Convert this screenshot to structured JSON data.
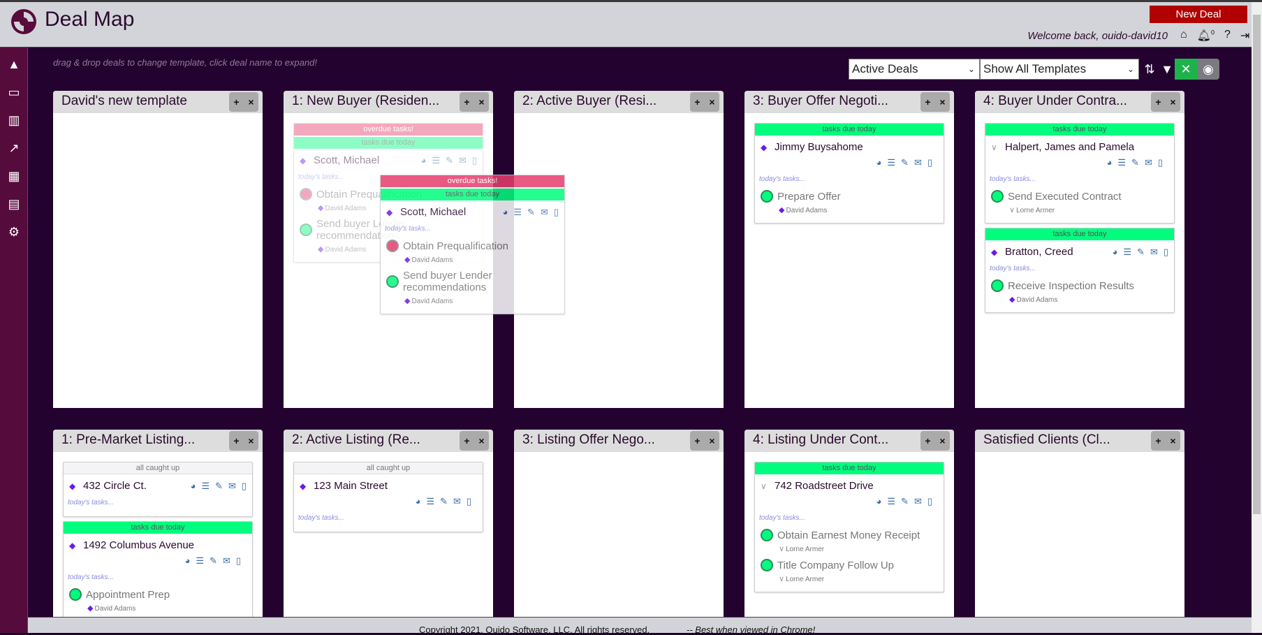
{
  "app": {
    "title": "Deal Map",
    "new_deal": "New Deal",
    "welcome": "Welcome back, ouido-david10",
    "notif_count": "0"
  },
  "hint": "drag & drop deals to change template, click deal name to expand!",
  "filters": {
    "deal_filter": "Active Deals",
    "template_filter": "Show All Templates"
  },
  "colors": {
    "overdue": "#e63e6d",
    "due_today": "#00fd7e",
    "diamond": "#6a1be8",
    "header": "#d3d4d9",
    "background": "#24022f",
    "sidebar": "#560b3d",
    "new_deal": "#b00000"
  },
  "sidebar": [
    "rocket-icon",
    "monitor-icon",
    "map-icon",
    "chart-icon",
    "calendar-icon",
    "contact-card-icon",
    "settings-icon"
  ],
  "columns": [
    {
      "title": "David's new template",
      "deals": []
    },
    {
      "title": "1: New Buyer (Residen...",
      "deals": [
        {
          "ghost": true,
          "banners": [
            {
              "type": "overdue",
              "text": "overdue tasks!"
            },
            {
              "type": "today",
              "text": "tasks due today"
            }
          ],
          "name": "Scott, Michael",
          "marker": "diamond",
          "icons_below": false,
          "todays": "today's tasks...",
          "tasks": [
            {
              "name": "Obtain Prequalification",
              "status": "overdue",
              "assignee": "David Adams",
              "amarker": "diamond"
            },
            {
              "name": "Send buyer Lender recommendations",
              "status": "today",
              "assignee": "David Adams",
              "amarker": "diamond"
            }
          ]
        }
      ]
    },
    {
      "title": "2: Active Buyer (Resi...",
      "deals": []
    },
    {
      "title": "3: Buyer Offer Negoti...",
      "deals": [
        {
          "banners": [
            {
              "type": "today",
              "text": "tasks due today"
            }
          ],
          "name": "Jimmy Buysahome",
          "marker": "diamond",
          "icons_below": true,
          "todays": "today's tasks...",
          "tasks": [
            {
              "name": "Prepare Offer",
              "status": "today",
              "assignee": "David Adams",
              "amarker": "diamond"
            }
          ]
        }
      ]
    },
    {
      "title": "4: Buyer Under Contra...",
      "deals": [
        {
          "banners": [
            {
              "type": "today",
              "text": "tasks due today"
            }
          ],
          "name": "Halpert, James and Pamela",
          "marker": "chevron",
          "icons_below": true,
          "todays": "today's tasks...",
          "tasks": [
            {
              "name": "Send Executed Contract",
              "status": "today",
              "assignee": "Lorne Armer",
              "amarker": "chevron"
            }
          ]
        },
        {
          "banners": [
            {
              "type": "today",
              "text": "tasks due today"
            }
          ],
          "name": "Bratton, Creed",
          "marker": "diamond",
          "icons_below": false,
          "todays": "today's tasks...",
          "tasks": [
            {
              "name": "Receive Inspection Results",
              "status": "today",
              "assignee": "David Adams",
              "amarker": "diamond"
            }
          ]
        }
      ]
    },
    {
      "title": "1: Pre-Market Listing...",
      "deals": [
        {
          "banners": [
            {
              "type": "caught",
              "text": "all caught up"
            }
          ],
          "name": "432 Circle Ct.",
          "marker": "diamond",
          "icons_below": false,
          "todays": "today's tasks...",
          "tasks": []
        },
        {
          "banners": [
            {
              "type": "today",
              "text": "tasks due today"
            }
          ],
          "name": "1492 Columbus Avenue",
          "marker": "diamond",
          "icons_below": true,
          "todays": "today's tasks...",
          "tasks": [
            {
              "name": "Appointment Prep",
              "status": "today",
              "assignee": "David Adams",
              "amarker": "diamond"
            }
          ]
        }
      ]
    },
    {
      "title": "2: Active Listing (Re...",
      "deals": [
        {
          "banners": [
            {
              "type": "caught",
              "text": "all caught up"
            }
          ],
          "name": "123 Main Street",
          "marker": "diamond",
          "icons_below": true,
          "todays": "today's tasks...",
          "tasks": []
        }
      ]
    },
    {
      "title": "3: Listing Offer Nego...",
      "deals": []
    },
    {
      "title": "4: Listing Under Cont...",
      "deals": [
        {
          "banners": [
            {
              "type": "today",
              "text": "tasks due today"
            }
          ],
          "name": "742 Roadstreet Drive",
          "marker": "chevron",
          "icons_below": true,
          "todays": "today's tasks...",
          "tasks": [
            {
              "name": "Obtain Earnest Money Receipt",
              "status": "today",
              "assignee": "Lorne Armer",
              "amarker": "chevron"
            },
            {
              "name": "Title Company Follow Up",
              "status": "today",
              "assignee": "Lorne Armer",
              "amarker": "chevron"
            }
          ]
        }
      ]
    },
    {
      "title": "Satisfied Clients (Cl...",
      "deals": []
    }
  ],
  "dragging": {
    "banners": [
      {
        "type": "overdue",
        "text": "overdue tasks!"
      },
      {
        "type": "today",
        "text": "tasks due today"
      }
    ],
    "name": "Scott, Michael",
    "marker": "diamond",
    "icons_below": false,
    "todays": "today's tasks...",
    "tasks": [
      {
        "name": "Obtain Prequalification",
        "status": "overdue",
        "assignee": "David Adams",
        "amarker": "diamond"
      },
      {
        "name": "Send buyer Lender recommendations",
        "status": "today",
        "assignee": "David Adams",
        "amarker": "diamond"
      }
    ]
  },
  "footer": {
    "copyright": "Copyright 2021, Ouido Software, LLC. All rights reserved.",
    "note": "-- Best when viewed in Chrome!"
  }
}
